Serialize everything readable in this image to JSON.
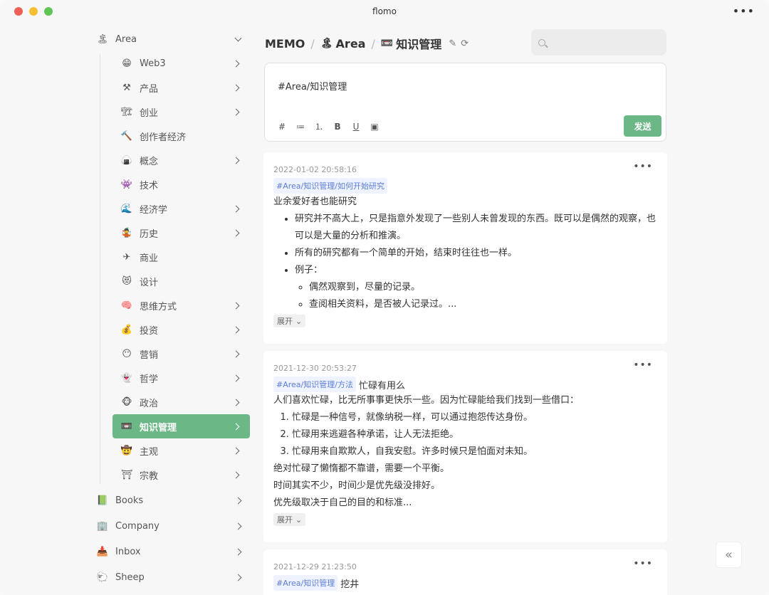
{
  "app": {
    "title": "flomo"
  },
  "sidebar": {
    "area": {
      "emoji": "🏝",
      "label": "Area"
    },
    "items": [
      {
        "emoji": "😁",
        "label": "Web3",
        "chevron": true
      },
      {
        "emoji": "⚒",
        "label": "产品",
        "chevron": true
      },
      {
        "emoji": "🏗",
        "label": "创业",
        "chevron": true
      },
      {
        "emoji": "🔨",
        "label": "创作者经济",
        "chevron": false
      },
      {
        "emoji": "🍙",
        "label": "概念",
        "chevron": true
      },
      {
        "emoji": "👾",
        "label": "技术",
        "chevron": false
      },
      {
        "emoji": "🌊",
        "label": "经济学",
        "chevron": true
      },
      {
        "emoji": "🤹",
        "label": "历史",
        "chevron": true
      },
      {
        "emoji": "✈",
        "label": "商业",
        "chevron": false
      },
      {
        "emoji": "😻",
        "label": "设计",
        "chevron": false
      },
      {
        "emoji": "🧠",
        "label": "思维方式",
        "chevron": true
      },
      {
        "emoji": "💰",
        "label": "投资",
        "chevron": true
      },
      {
        "emoji": "😶",
        "label": "营销",
        "chevron": true
      },
      {
        "emoji": "👻",
        "label": "哲学",
        "chevron": true
      },
      {
        "emoji": "🐵",
        "label": "政治",
        "chevron": true
      },
      {
        "emoji": "📼",
        "label": "知识管理",
        "chevron": true,
        "active": true
      },
      {
        "emoji": "🤠",
        "label": "主观",
        "chevron": true
      },
      {
        "emoji": "⛩",
        "label": "宗教",
        "chevron": true
      }
    ],
    "roots": [
      {
        "emoji": "📗",
        "label": "Books"
      },
      {
        "emoji": "🏢",
        "label": "Company"
      },
      {
        "emoji": "📥",
        "label": "Inbox"
      },
      {
        "emoji": "🐑",
        "label": "Sheep"
      }
    ]
  },
  "header": {
    "memo": "MEMO",
    "area_emoji": "🏝",
    "area": "Area",
    "current_emoji": "📼",
    "current": "知识管理"
  },
  "search": {
    "placeholder": ""
  },
  "editor": {
    "text": "#Area/知识管理",
    "send_label": "发送",
    "tools": [
      "#",
      "≔",
      "⒈",
      "B",
      "U",
      "▣"
    ]
  },
  "memos": [
    {
      "time": "2022-01-02 20:58:16",
      "tag": "#Area/知识管理/如何开始研究",
      "tag_suffix": "",
      "intro": "业余爱好者也能研究",
      "bullets": [
        "研究并不高大上，只是指意外发现了一些别人未曾发现的东西。既可以是偶然的观察，也可以是大量的分析和推演。",
        "所有的研究都有一个简单的开始，结束时往往也一样。",
        "例子："
      ],
      "sub_bullets": [
        "偶然观察到，尽量的记录。",
        "查阅相关资料，是否被人记录过。..."
      ],
      "expand": "展开"
    },
    {
      "time": "2021-12-30 20:53:27",
      "tag": "#Area/知识管理/方法",
      "tag_suffix": "忙碌有用么",
      "intro": "人们喜欢忙碌，比无所事事更快乐一些。因为忙碌能给我们找到一些借口：",
      "numbered": [
        "忙碌是一种信号，就像纳税一样，可以通过抱怨传达身份。",
        "忙碌用来逃避各种承诺，让人无法拒绝。",
        "忙碌用来自欺欺人，自我安慰。许多时候只是怕面对未知。"
      ],
      "paragraphs": [
        "绝对忙碌了懒惰都不靠谱，需要一个平衡。",
        "时间其实不少，时间少是优先级没排好。",
        "优先级取决于自己的目的和标准..."
      ],
      "expand": "展开"
    },
    {
      "time": "2021-12-29 21:23:50",
      "tag": "#Area/知识管理",
      "tag_suffix": "挖井"
    }
  ]
}
